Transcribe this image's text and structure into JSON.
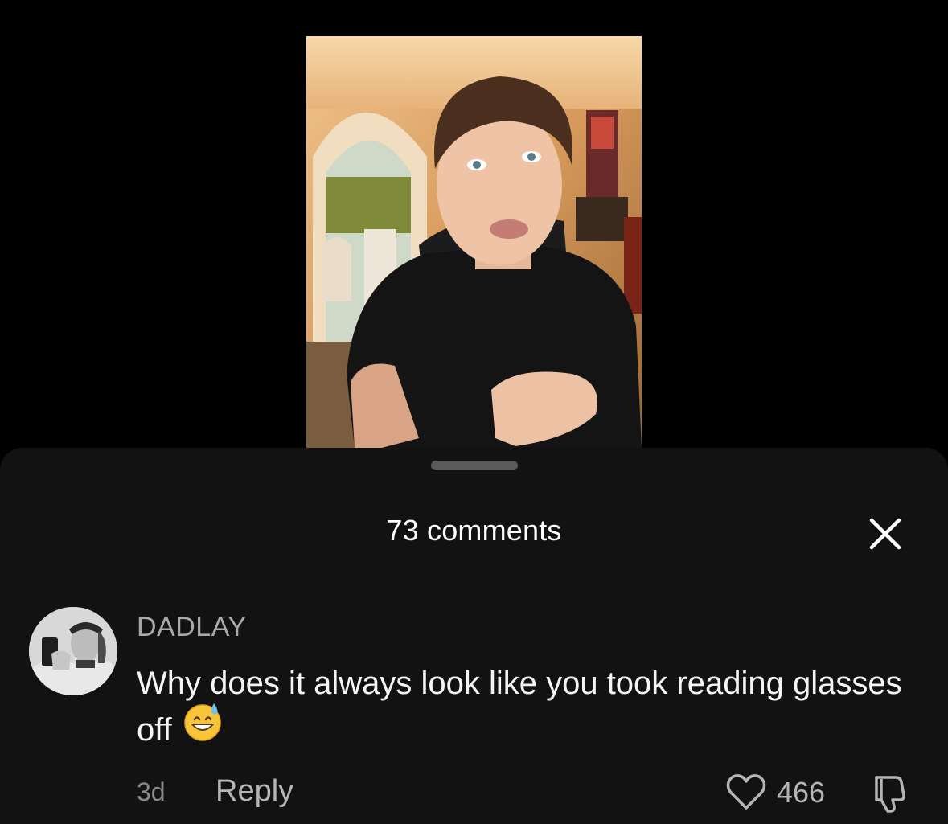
{
  "video": {
    "thumbnail": "person-talking-in-room"
  },
  "sheet": {
    "title": "73 comments",
    "close_icon": "close-icon"
  },
  "comment": {
    "username": "DADLAY",
    "text": "Why does it always look like you took reading glasses off",
    "emoji": "grinning-face-with-sweat",
    "time": "3d",
    "reply_label": "Reply",
    "like_count": "466",
    "like_icon": "heart-icon",
    "dislike_icon": "thumbs-down-icon"
  },
  "colors": {
    "background": "#000000",
    "sheet": "#121212",
    "muted_text": "#a9a9a9"
  }
}
